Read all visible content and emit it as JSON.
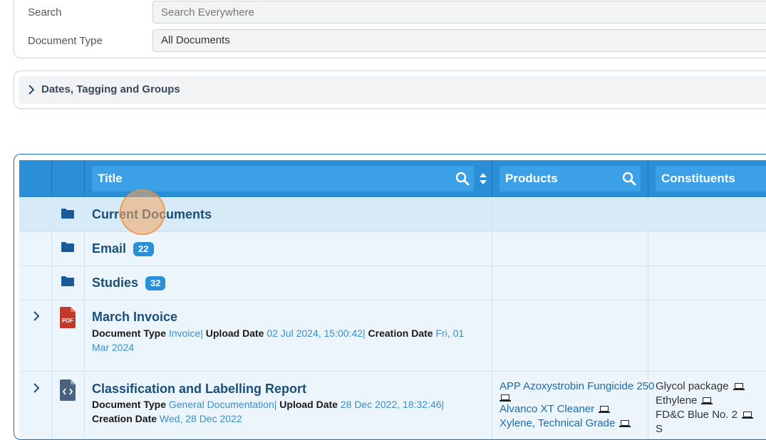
{
  "filters": {
    "search": {
      "label": "Search",
      "placeholder": "Search Everywhere",
      "value": ""
    },
    "document_type": {
      "label": "Document Type",
      "value": "All Documents"
    }
  },
  "accordion": {
    "label": "Dates, Tagging and Groups"
  },
  "table": {
    "columns": {
      "title": "Title",
      "products": "Products",
      "constituents": "Constituents"
    },
    "rows": [
      {
        "title": "Current Documents",
        "icon": "folder-icon"
      },
      {
        "title": "Email",
        "icon": "folder-icon",
        "badge": "22"
      },
      {
        "title": "Studies",
        "icon": "folder-icon",
        "badge": "32"
      },
      {
        "title": "March Invoice",
        "icon": "pdf-file-icon",
        "meta": {
          "doctype_key": "Document Type",
          "doctype_val": "Invoice",
          "upload_key": "Upload Date",
          "upload_val": "02 Jul 2024, 15:00:42",
          "creation_key": "Creation Date",
          "creation_val": "Fri, 01 Mar 2024"
        }
      },
      {
        "title": "Classification and Labelling Report",
        "icon": "code-file-icon",
        "meta": {
          "doctype_key": "Document Type",
          "doctype_val": "General Documentation",
          "upload_key": "Upload Date",
          "upload_val": "28 Dec 2022, 18:32:46",
          "creation_key": "Creation Date",
          "creation_val": "Wed, 28 Dec 2022"
        },
        "products": [
          "APP Azoxystrobin Fungicide 250",
          "Alvanco XT Cleaner",
          "Xylene, Technical Grade"
        ],
        "constituents": [
          "Glycol package",
          "Ethylene",
          "FD&C Blue No. 2",
          "S"
        ]
      }
    ]
  },
  "colors": {
    "header": "#2a8fd6",
    "row": "#ebf5fb",
    "link": "#1e6aab",
    "pdf": "#c0392b",
    "folder": "#1a5a96"
  }
}
